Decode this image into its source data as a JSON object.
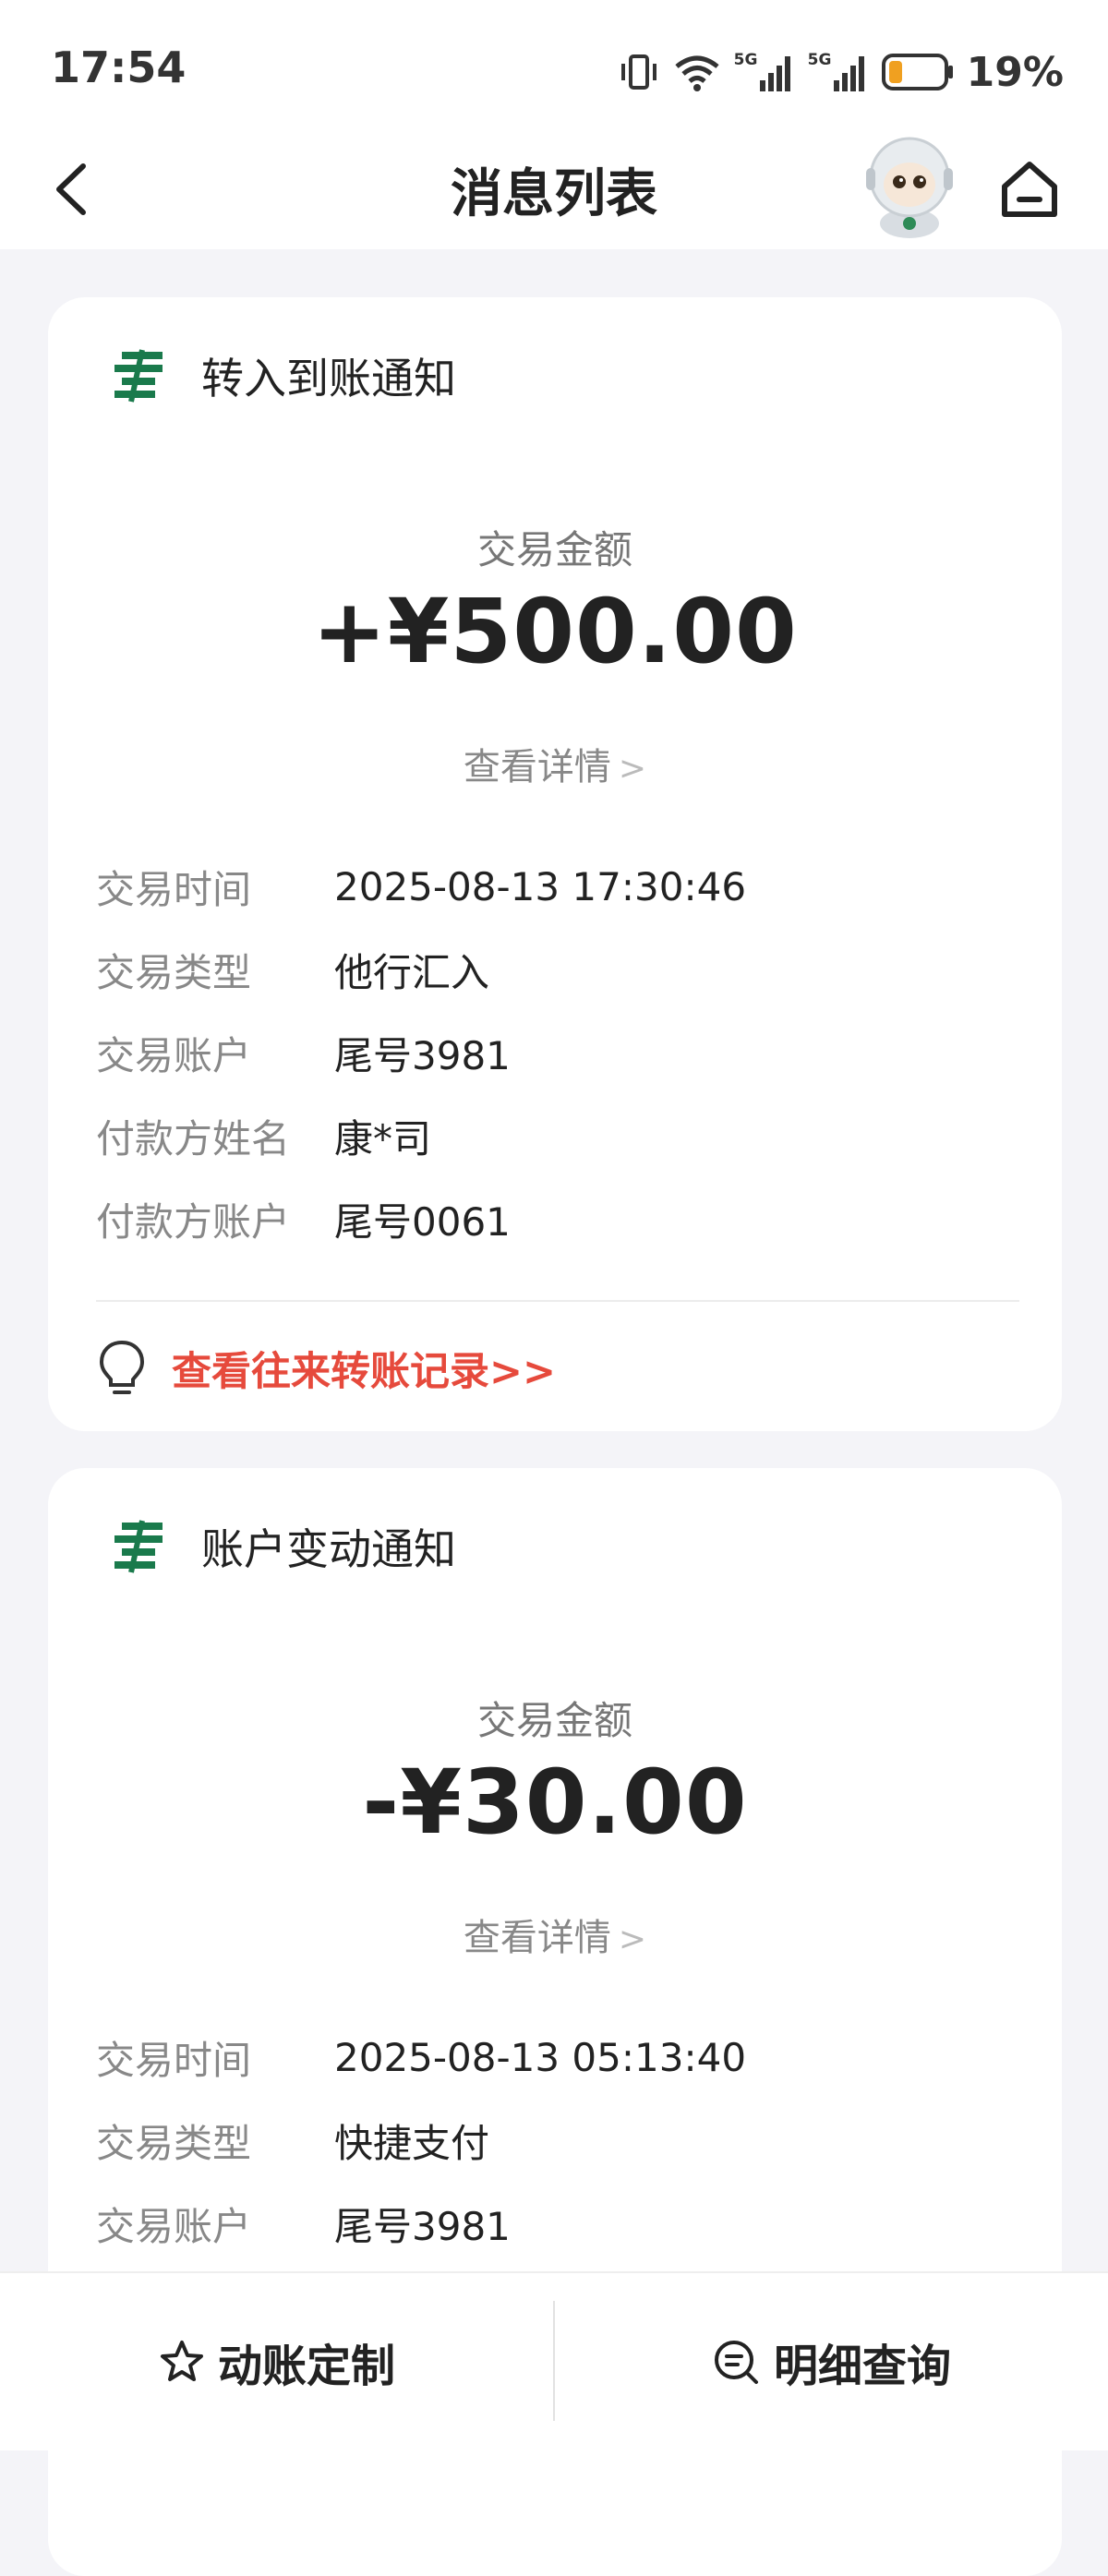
{
  "status_bar": {
    "time": "17:54",
    "battery_percent": "19%",
    "network_1": "5G",
    "network_2": "5G"
  },
  "header": {
    "title": "消息列表"
  },
  "messages": [
    {
      "title": "转入到账通知",
      "amount_label": "交易金额",
      "amount": "+¥500.00",
      "detail_link": "查看详情",
      "fields": [
        {
          "k": "交易时间",
          "v": "2025-08-13 17:30:46"
        },
        {
          "k": "交易类型",
          "v": "他行汇入"
        },
        {
          "k": "交易账户",
          "v": "尾号3981"
        },
        {
          "k": "付款方姓名",
          "v": "康*司"
        },
        {
          "k": "付款方账户",
          "v": "尾号0061"
        }
      ],
      "history_link": "查看往来转账记录>>"
    },
    {
      "title": "账户变动通知",
      "amount_label": "交易金额",
      "amount": "-¥30.00",
      "detail_link": "查看详情",
      "fields": [
        {
          "k": "交易时间",
          "v": "2025-08-13 05:13:40"
        },
        {
          "k": "交易类型",
          "v": "快捷支付"
        },
        {
          "k": "交易账户",
          "v": "尾号3981"
        }
      ]
    }
  ],
  "bottom_bar": {
    "left_label": "动账定制",
    "right_label": "明细查询"
  },
  "colors": {
    "accent_red": "#e64a3c",
    "postal_green": "#1a7a4c"
  }
}
